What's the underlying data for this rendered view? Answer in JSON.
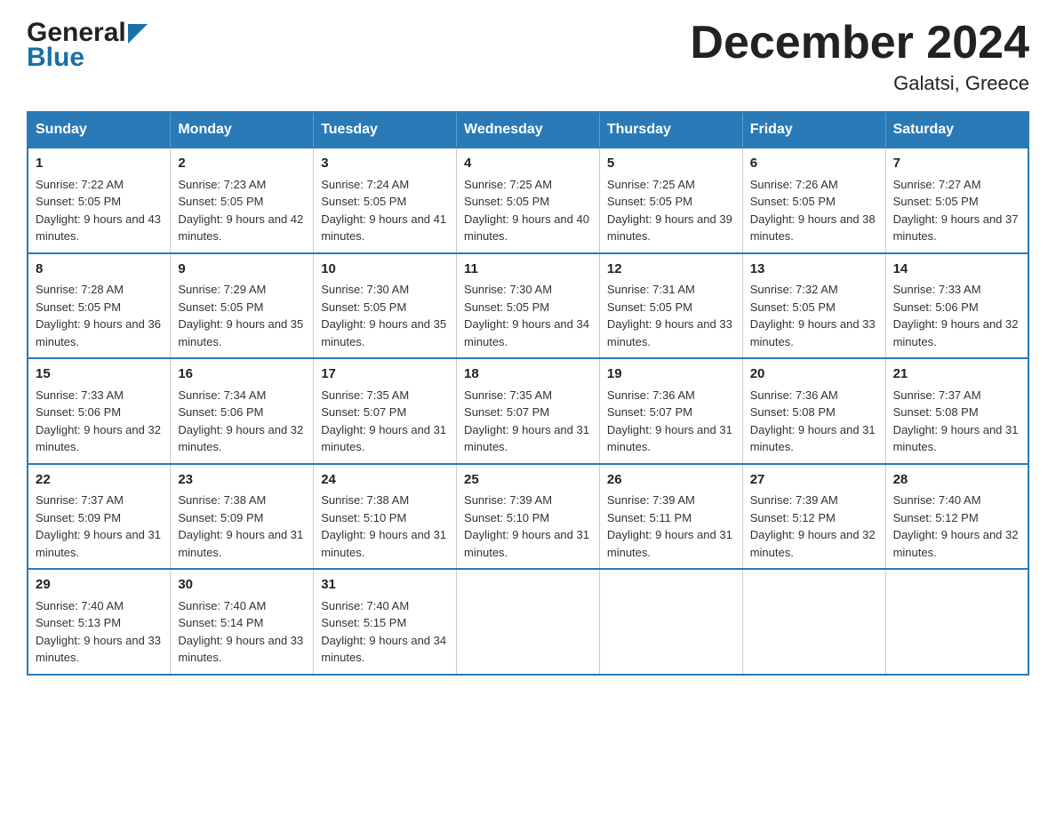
{
  "header": {
    "logo_general": "General",
    "logo_blue": "Blue",
    "title": "December 2024",
    "subtitle": "Galatsi, Greece"
  },
  "weekdays": [
    "Sunday",
    "Monday",
    "Tuesday",
    "Wednesday",
    "Thursday",
    "Friday",
    "Saturday"
  ],
  "weeks": [
    [
      {
        "day": "1",
        "sunrise": "Sunrise: 7:22 AM",
        "sunset": "Sunset: 5:05 PM",
        "daylight": "Daylight: 9 hours and 43 minutes."
      },
      {
        "day": "2",
        "sunrise": "Sunrise: 7:23 AM",
        "sunset": "Sunset: 5:05 PM",
        "daylight": "Daylight: 9 hours and 42 minutes."
      },
      {
        "day": "3",
        "sunrise": "Sunrise: 7:24 AM",
        "sunset": "Sunset: 5:05 PM",
        "daylight": "Daylight: 9 hours and 41 minutes."
      },
      {
        "day": "4",
        "sunrise": "Sunrise: 7:25 AM",
        "sunset": "Sunset: 5:05 PM",
        "daylight": "Daylight: 9 hours and 40 minutes."
      },
      {
        "day": "5",
        "sunrise": "Sunrise: 7:25 AM",
        "sunset": "Sunset: 5:05 PM",
        "daylight": "Daylight: 9 hours and 39 minutes."
      },
      {
        "day": "6",
        "sunrise": "Sunrise: 7:26 AM",
        "sunset": "Sunset: 5:05 PM",
        "daylight": "Daylight: 9 hours and 38 minutes."
      },
      {
        "day": "7",
        "sunrise": "Sunrise: 7:27 AM",
        "sunset": "Sunset: 5:05 PM",
        "daylight": "Daylight: 9 hours and 37 minutes."
      }
    ],
    [
      {
        "day": "8",
        "sunrise": "Sunrise: 7:28 AM",
        "sunset": "Sunset: 5:05 PM",
        "daylight": "Daylight: 9 hours and 36 minutes."
      },
      {
        "day": "9",
        "sunrise": "Sunrise: 7:29 AM",
        "sunset": "Sunset: 5:05 PM",
        "daylight": "Daylight: 9 hours and 35 minutes."
      },
      {
        "day": "10",
        "sunrise": "Sunrise: 7:30 AM",
        "sunset": "Sunset: 5:05 PM",
        "daylight": "Daylight: 9 hours and 35 minutes."
      },
      {
        "day": "11",
        "sunrise": "Sunrise: 7:30 AM",
        "sunset": "Sunset: 5:05 PM",
        "daylight": "Daylight: 9 hours and 34 minutes."
      },
      {
        "day": "12",
        "sunrise": "Sunrise: 7:31 AM",
        "sunset": "Sunset: 5:05 PM",
        "daylight": "Daylight: 9 hours and 33 minutes."
      },
      {
        "day": "13",
        "sunrise": "Sunrise: 7:32 AM",
        "sunset": "Sunset: 5:05 PM",
        "daylight": "Daylight: 9 hours and 33 minutes."
      },
      {
        "day": "14",
        "sunrise": "Sunrise: 7:33 AM",
        "sunset": "Sunset: 5:06 PM",
        "daylight": "Daylight: 9 hours and 32 minutes."
      }
    ],
    [
      {
        "day": "15",
        "sunrise": "Sunrise: 7:33 AM",
        "sunset": "Sunset: 5:06 PM",
        "daylight": "Daylight: 9 hours and 32 minutes."
      },
      {
        "day": "16",
        "sunrise": "Sunrise: 7:34 AM",
        "sunset": "Sunset: 5:06 PM",
        "daylight": "Daylight: 9 hours and 32 minutes."
      },
      {
        "day": "17",
        "sunrise": "Sunrise: 7:35 AM",
        "sunset": "Sunset: 5:07 PM",
        "daylight": "Daylight: 9 hours and 31 minutes."
      },
      {
        "day": "18",
        "sunrise": "Sunrise: 7:35 AM",
        "sunset": "Sunset: 5:07 PM",
        "daylight": "Daylight: 9 hours and 31 minutes."
      },
      {
        "day": "19",
        "sunrise": "Sunrise: 7:36 AM",
        "sunset": "Sunset: 5:07 PM",
        "daylight": "Daylight: 9 hours and 31 minutes."
      },
      {
        "day": "20",
        "sunrise": "Sunrise: 7:36 AM",
        "sunset": "Sunset: 5:08 PM",
        "daylight": "Daylight: 9 hours and 31 minutes."
      },
      {
        "day": "21",
        "sunrise": "Sunrise: 7:37 AM",
        "sunset": "Sunset: 5:08 PM",
        "daylight": "Daylight: 9 hours and 31 minutes."
      }
    ],
    [
      {
        "day": "22",
        "sunrise": "Sunrise: 7:37 AM",
        "sunset": "Sunset: 5:09 PM",
        "daylight": "Daylight: 9 hours and 31 minutes."
      },
      {
        "day": "23",
        "sunrise": "Sunrise: 7:38 AM",
        "sunset": "Sunset: 5:09 PM",
        "daylight": "Daylight: 9 hours and 31 minutes."
      },
      {
        "day": "24",
        "sunrise": "Sunrise: 7:38 AM",
        "sunset": "Sunset: 5:10 PM",
        "daylight": "Daylight: 9 hours and 31 minutes."
      },
      {
        "day": "25",
        "sunrise": "Sunrise: 7:39 AM",
        "sunset": "Sunset: 5:10 PM",
        "daylight": "Daylight: 9 hours and 31 minutes."
      },
      {
        "day": "26",
        "sunrise": "Sunrise: 7:39 AM",
        "sunset": "Sunset: 5:11 PM",
        "daylight": "Daylight: 9 hours and 31 minutes."
      },
      {
        "day": "27",
        "sunrise": "Sunrise: 7:39 AM",
        "sunset": "Sunset: 5:12 PM",
        "daylight": "Daylight: 9 hours and 32 minutes."
      },
      {
        "day": "28",
        "sunrise": "Sunrise: 7:40 AM",
        "sunset": "Sunset: 5:12 PM",
        "daylight": "Daylight: 9 hours and 32 minutes."
      }
    ],
    [
      {
        "day": "29",
        "sunrise": "Sunrise: 7:40 AM",
        "sunset": "Sunset: 5:13 PM",
        "daylight": "Daylight: 9 hours and 33 minutes."
      },
      {
        "day": "30",
        "sunrise": "Sunrise: 7:40 AM",
        "sunset": "Sunset: 5:14 PM",
        "daylight": "Daylight: 9 hours and 33 minutes."
      },
      {
        "day": "31",
        "sunrise": "Sunrise: 7:40 AM",
        "sunset": "Sunset: 5:15 PM",
        "daylight": "Daylight: 9 hours and 34 minutes."
      },
      null,
      null,
      null,
      null
    ]
  ]
}
